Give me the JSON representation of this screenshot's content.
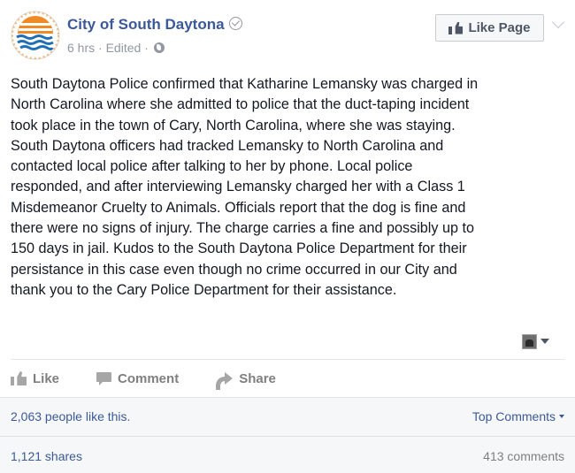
{
  "post": {
    "page_name": "City of South Daytona",
    "time": "6 hrs",
    "edited": "Edited",
    "separator": "·",
    "like_page_label": "Like Page",
    "body_lines": [
      "South Daytona Police confirmed that Katharine Lemansky was charged in",
      "North Carolina where she admitted to police that the duct-taping incident",
      "took place in the town of Cary, North Carolina, where she was staying.",
      "South Daytona officers had tracked Lemansky to North Carolina and",
      "contacted local police after talking to her by phone. Local police",
      "responded, and after interviewing Lemansky charged her with a Class 1",
      "Misdemeanor Cruelty to Animals. Officials report that the dog is fine and",
      "there were no signs of injury. The charge carries a fine and possibly up to",
      "150 days in jail. Kudos to the South Daytona Police Department for their",
      "persistance in this case even though no crime occurred in our City and",
      "thank you to the Cary Police Department for their assistance."
    ]
  },
  "actions": {
    "like": "Like",
    "comment": "Comment",
    "share": "Share"
  },
  "stats": {
    "likes": "2,063 people like this.",
    "top_comments": "Top Comments",
    "shares": "1,121 shares",
    "comments": "413 comments"
  },
  "colors": {
    "link": "#3b5998",
    "logo_orange": "#f08a24",
    "logo_blue": "#1f6fb5"
  },
  "icons": {
    "verified": "verified-check-icon",
    "globe": "globe-icon",
    "like": "thumbs-up-icon",
    "comment": "comment-bubble-icon",
    "share": "share-arrow-icon",
    "tag": "tag-photo-icon",
    "menu": "chevron-down-icon"
  }
}
